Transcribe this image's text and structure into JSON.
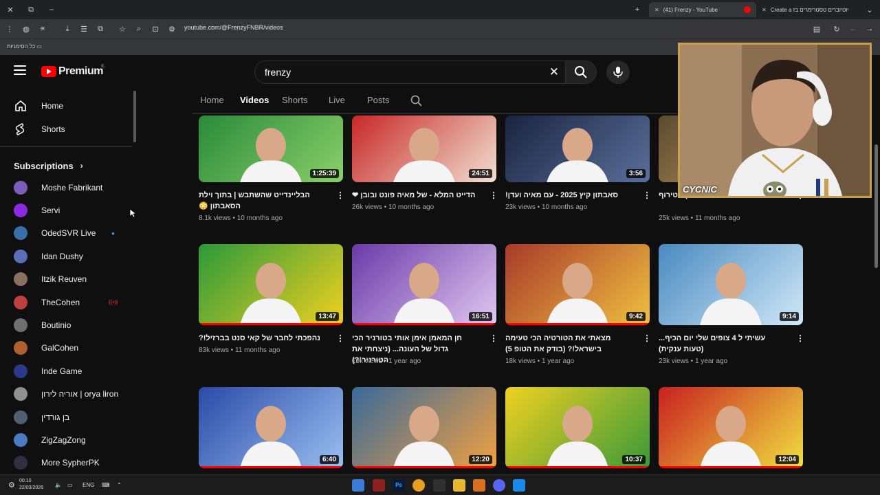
{
  "browser": {
    "tabs": [
      {
        "label": "(41) Frenzy - YouTube"
      },
      {
        "label": "Create a יוטיוברים טסטרימרים בז"
      }
    ],
    "url": "youtube.com/@FrenzyFNBR/videos",
    "bookmark_all": "כל הסימניות"
  },
  "youtube": {
    "logo": "Premium",
    "country": "IL",
    "search_value": "frenzy"
  },
  "sidebar": {
    "home": "Home",
    "shorts": "Shorts",
    "subscriptions_title": "Subscriptions",
    "subscriptions": [
      {
        "name": "Moshe Fabrikant",
        "color": "#7a5fb8"
      },
      {
        "name": "Servi",
        "color": "#8a2be2"
      },
      {
        "name": "OdedSVR Live",
        "color": "#3a6fa8"
      },
      {
        "name": "Idan Dushy",
        "color": "#5a6fb8"
      },
      {
        "name": "Itzik Reuven",
        "color": "#8a7060"
      },
      {
        "name": "TheCohen",
        "color": "#c04040"
      },
      {
        "name": "Boutinio",
        "color": "#707070"
      },
      {
        "name": "GalCohen",
        "color": "#b06030"
      },
      {
        "name": "Inde Game",
        "color": "#2a3a8a"
      },
      {
        "name": "אוריה לירון | orya liron",
        "color": "#909090"
      },
      {
        "name": "בן גורדין",
        "color": "#506070"
      },
      {
        "name": "ZigZagZong",
        "color": "#4a7ac0"
      },
      {
        "name": "More SypherPK",
        "color": "#303040"
      }
    ]
  },
  "channel_tabs": [
    "Home",
    "Videos",
    "Shorts",
    "Live",
    "Posts"
  ],
  "videos": [
    {
      "title": "הבליינדייט שהשתבש | בתוך וילת הסאבתון 😳",
      "views": "8.1k views",
      "age": "10 months ago",
      "duration": "1:25:39",
      "colors": [
        "#2a8a3a",
        "#8ad06a"
      ],
      "progress": 0
    },
    {
      "title": "הדייט המלא - של מאיה פונט ובובן ❤",
      "views": "26k views",
      "age": "10 months ago",
      "duration": "24:51",
      "colors": [
        "#c82828",
        "#f0e0d0"
      ],
      "progress": 0
    },
    {
      "title": "סאבתון קיץ 2025 - עם מאיה ועדן!",
      "views": "23k views",
      "age": "10 months ago",
      "duration": "3:56",
      "colors": [
        "#1a2440",
        "#5a6f9a"
      ],
      "progress": 0
    },
    {
      "title": "טעים ) בטירוף",
      "views": "25k views",
      "age": "11 months ago",
      "duration": "",
      "colors": [
        "#5a4a30",
        "#c8a060"
      ],
      "progress": 0
    },
    {
      "title": "נהפכתי לחבר של קאי סנט בברזיל!?",
      "views": "83k views",
      "age": "11 months ago",
      "duration": "13:47",
      "colors": [
        "#2a9a3a",
        "#f0d020"
      ],
      "progress": 1
    },
    {
      "title": "חן המאמן אימן אותי בטורניר הכי גדול של העונה... (ניצחתי את הטורניר!?)",
      "views": "19k views",
      "age": "1 year ago",
      "duration": "16:51",
      "colors": [
        "#6a3aa8",
        "#e0c8f0"
      ],
      "progress": 1
    },
    {
      "title": "מצאתי את הטורטיה הכי טעימה בישראל!? (בודק את הטופ 5)",
      "views": "18k views",
      "age": "1 year ago",
      "duration": "9:42",
      "colors": [
        "#a83a2a",
        "#f0c040"
      ],
      "progress": 1
    },
    {
      "title": "עשיתי ל 4 צופים שלי יום הכיף... (טעות ענקית)",
      "views": "23k views",
      "age": "1 year ago",
      "duration": "9:14",
      "colors": [
        "#4a8ac0",
        "#d0e8f8"
      ],
      "progress": 0
    },
    {
      "title": "",
      "views": "",
      "age": "",
      "duration": "6:40",
      "colors": [
        "#2a4aa8",
        "#9ac0f0"
      ],
      "progress": 1
    },
    {
      "title": "",
      "views": "",
      "age": "",
      "duration": "12:20",
      "colors": [
        "#3a6a9a",
        "#f0a040"
      ],
      "progress": 1
    },
    {
      "title": "",
      "views": "",
      "age": "",
      "duration": "10:37",
      "colors": [
        "#f0d020",
        "#3a9a3a"
      ],
      "progress": 1
    },
    {
      "title": "",
      "views": "",
      "age": "",
      "duration": "12:04",
      "colors": [
        "#c82020",
        "#f0e040"
      ],
      "progress": 1
    }
  ],
  "webcam": {
    "overlay_name": "CYCNIC"
  },
  "taskbar": {
    "time": "00:10",
    "date": "22/03/2026",
    "lang": "ENG"
  }
}
